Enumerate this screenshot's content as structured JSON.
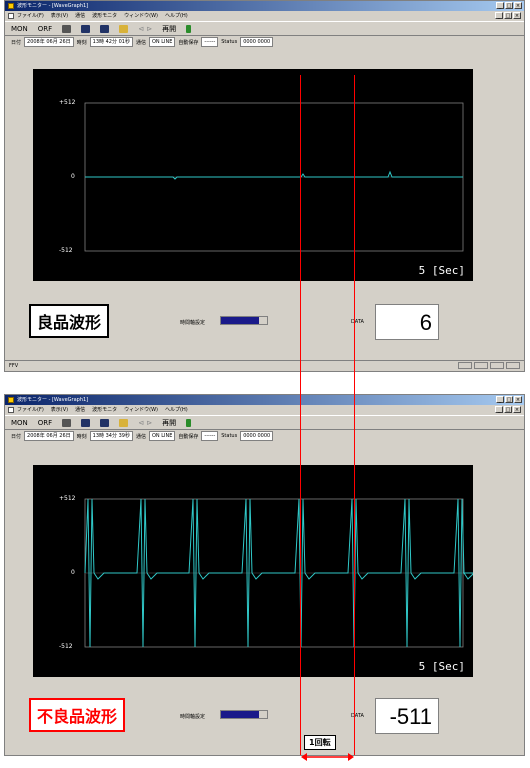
{
  "title": "波形モニター - [WaveGraph1]",
  "menu": [
    "ファイル(F)",
    "表示(V)",
    "通信",
    "波形モニタ",
    "ウィンドウ(W)",
    "ヘルプ(H)"
  ],
  "toolbar": {
    "mon": "MON",
    "orf": "ORF",
    "replay": "再開"
  },
  "info": {
    "date_label": "日付",
    "time_label": "時刻",
    "comm_label": "通信",
    "comm_value": "ON LINE",
    "autosave_label": "自動保存",
    "autosave_value": "------",
    "status_label": "Status",
    "status_value": "0000 0000"
  },
  "top": {
    "date": "2008年 06月 26日",
    "time": "13時 42分 01秒",
    "quality": "良品波形",
    "data_value": "6"
  },
  "bottom": {
    "date": "2008年 06月 26日",
    "time": "13時 34分 39秒",
    "quality": "不良品波形",
    "data_value": "-511"
  },
  "plot": {
    "ymax": "+512",
    "yzero": "0",
    "ymin": "-512",
    "time": "5 [Sec]"
  },
  "settings_label": "時間軸設定",
  "data_label": "DATA",
  "status_text": "FFV",
  "revolution_label": "1回転",
  "colors": {
    "trace": "#30c8c8",
    "accent": "#ff0000",
    "plot_bg": "#000000",
    "window_bg": "#d4d0c8"
  }
}
